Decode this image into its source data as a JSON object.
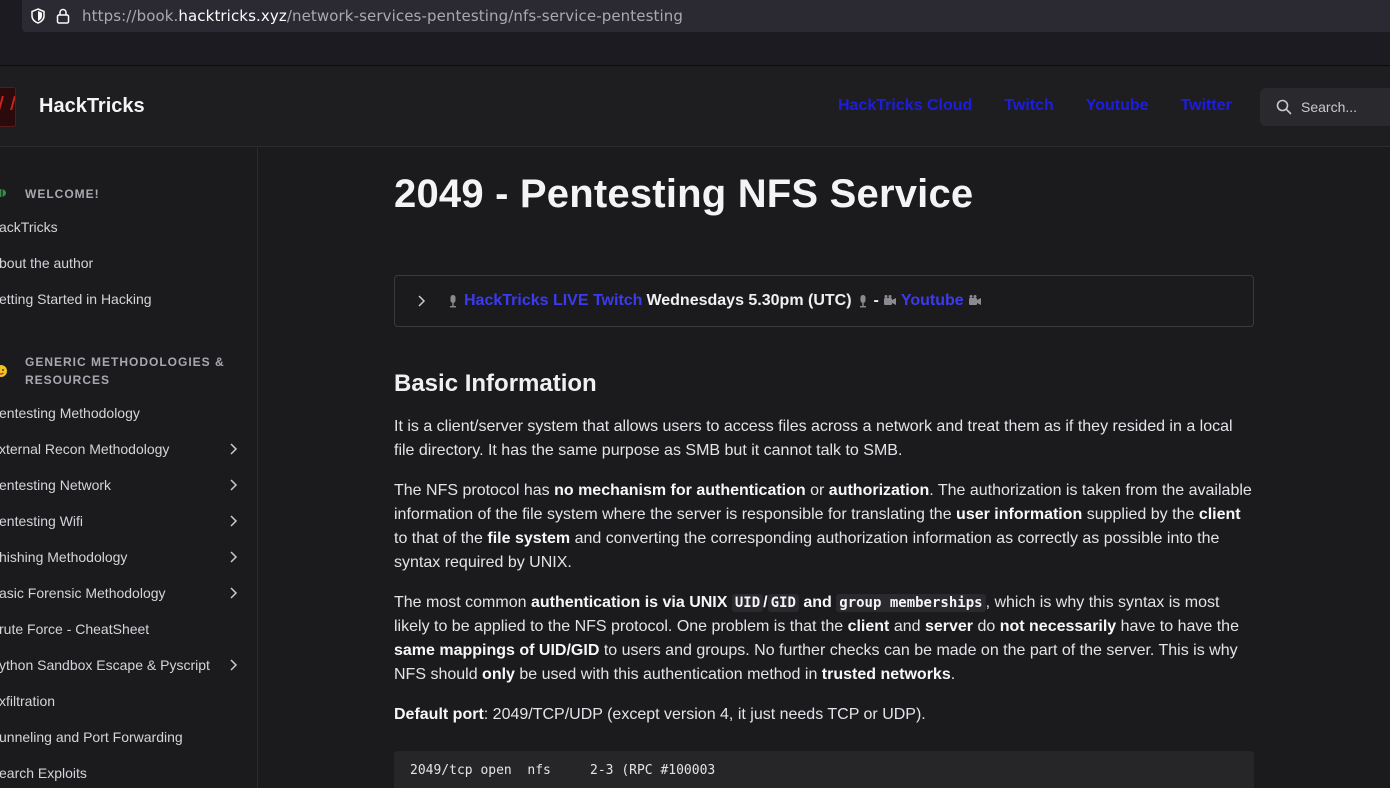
{
  "browser": {
    "url_prefix": "https://book.",
    "url_host": "hacktricks.xyz",
    "url_path": "/network-services-pentesting/nfs-service-pentesting"
  },
  "header": {
    "brand": "HackTricks",
    "nav": [
      "HackTricks Cloud",
      "Twitch",
      "Youtube",
      "Twitter"
    ],
    "search_placeholder": "Search..."
  },
  "sidebar": {
    "sections": [
      {
        "title": "WELCOME!",
        "icon": "bee-emoji-icon"
      },
      {
        "title": "GENERIC METHODOLOGIES & RESOURCES",
        "icon": "face-emoji-icon"
      }
    ],
    "welcome_items": [
      "ackTricks",
      "bout the author",
      "etting Started in Hacking"
    ],
    "generic_items": [
      {
        "label": "entesting Methodology",
        "expandable": false
      },
      {
        "label": "xternal Recon Methodology",
        "expandable": true
      },
      {
        "label": "entesting Network",
        "expandable": true
      },
      {
        "label": "entesting Wifi",
        "expandable": true
      },
      {
        "label": "hishing Methodology",
        "expandable": true
      },
      {
        "label": "asic Forensic Methodology",
        "expandable": true
      },
      {
        "label": "rute Force - CheatSheet",
        "expandable": false
      },
      {
        "label": "ython Sandbox Escape & Pyscript",
        "expandable": true
      },
      {
        "label": "xfiltration",
        "expandable": false
      },
      {
        "label": "unneling and Port Forwarding",
        "expandable": false
      },
      {
        "label": "earch Exploits",
        "expandable": false
      }
    ]
  },
  "main": {
    "title": "2049 - Pentesting NFS Service",
    "banner": {
      "link1": "HackTricks LIVE Twitch",
      "text1": "Wednesdays 5.30pm (UTC)",
      "sep": "-",
      "link2": "Youtube"
    },
    "section_title": "Basic Information",
    "p1": "It is a client/server system that allows users to access files across a network and treat them as if they resided in a local file directory. It has the same purpose as SMB but it cannot talk to SMB.",
    "p2": {
      "a": "The NFS protocol has ",
      "b1": "no mechanism for authentication",
      "c": " or ",
      "b2": "authorization",
      "d": ". The authorization is taken from the available information of the file system where the server is responsible for translating the ",
      "b3": "user information",
      "e": " supplied by the ",
      "b4": "client",
      "f": " to that of the ",
      "b5": "file system",
      "g": " and converting the corresponding authorization information as correctly as possible into the syntax required by UNIX."
    },
    "p3": {
      "a": "The most common ",
      "b1": "authentication is via UNIX ",
      "code1": "UID",
      "slash": "/",
      "code2": "GID",
      "and": " and ",
      "code3": "group memberships",
      "c": ", which is why this syntax is most likely to be applied to the NFS protocol. One problem is that the ",
      "b2": "client",
      "d": " and ",
      "b3": "server",
      "e": " do ",
      "b4": "not necessarily",
      "f": " have to have the ",
      "b5": "same mappings of UID/GID",
      "g": " to users and groups. No further checks can be made on the part of the server. This is why NFS should ",
      "b6": "only",
      "h": " be used with this authentication method in ",
      "b7": "trusted networks",
      "i": "."
    },
    "p4": {
      "b1": "Default port",
      "a": ": 2049/TCP/UDP (except version 4, it just needs TCP or UDP)."
    },
    "code": "2049/tcp open  nfs     2-3 (RPC #100003"
  }
}
